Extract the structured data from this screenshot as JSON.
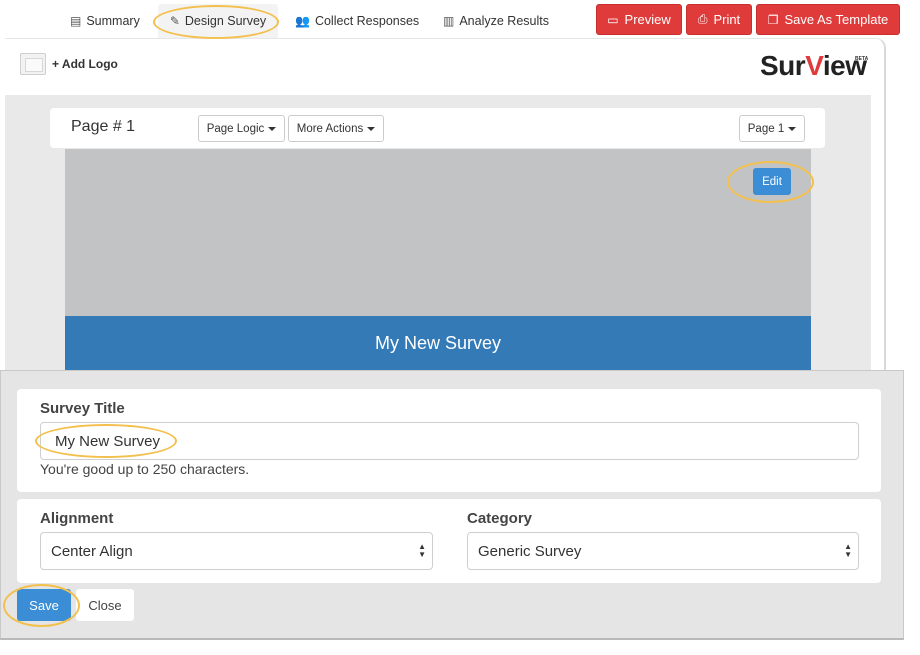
{
  "nav": {
    "tabs": [
      {
        "label": "Summary",
        "icon": "newspaper-icon"
      },
      {
        "label": "Design Survey",
        "icon": "edit-icon"
      },
      {
        "label": "Collect Responses",
        "icon": "users-icon"
      },
      {
        "label": "Analyze Results",
        "icon": "bar-chart-icon"
      }
    ],
    "actions": [
      {
        "label": "Preview",
        "icon": "monitor-icon"
      },
      {
        "label": "Print",
        "icon": "printer-icon"
      },
      {
        "label": "Save As Template",
        "icon": "copy-icon"
      }
    ],
    "accent": "#e03b3b"
  },
  "header": {
    "add_logo": "+ Add Logo",
    "brand_a": "Sur",
    "brand_b": "V",
    "brand_c": "iew",
    "beta": "BETA"
  },
  "page": {
    "title": "Page # 1",
    "page_logic": "Page Logic",
    "more_actions": "More Actions",
    "page_select": "Page 1",
    "edit": "Edit",
    "survey_title_display": "My New Survey",
    "title_bar_color": "#337ab7"
  },
  "settings": {
    "survey_title_label": "Survey Title",
    "survey_title_value": "My New Survey",
    "help_text": "You're good up to 250 characters.",
    "alignment_label": "Alignment",
    "alignment_value": "Center Align",
    "category_label": "Category",
    "category_value": "Generic Survey",
    "save": "Save",
    "close": "Close",
    "button_color": "#3b8ed6"
  }
}
